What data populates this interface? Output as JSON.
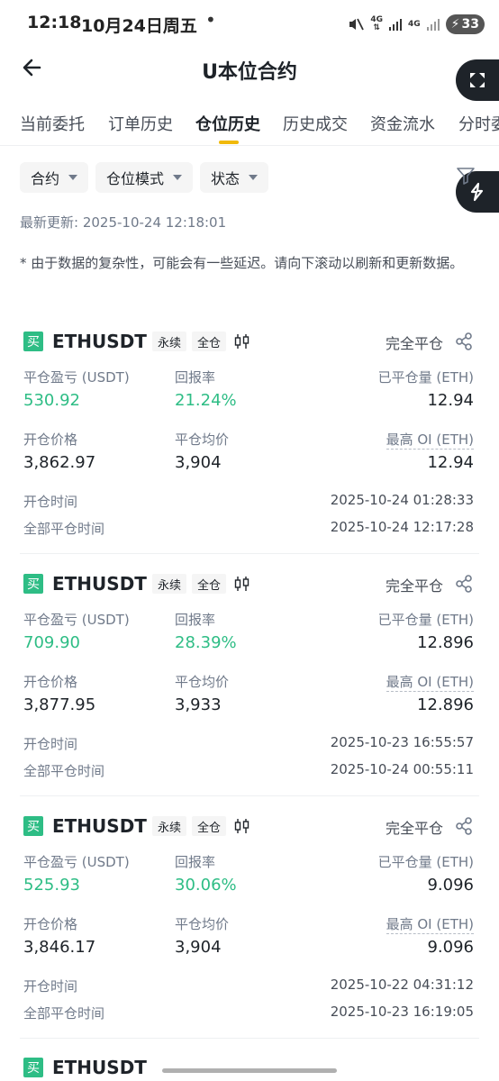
{
  "status_bar": {
    "time": "12:18",
    "date": "10月24日周五",
    "dot": "•",
    "net1": "4G",
    "net2": "4G",
    "battery": "33"
  },
  "header": {
    "title": "U本位合约"
  },
  "tabs": [
    {
      "label": "当前委托",
      "active": false
    },
    {
      "label": "订单历史",
      "active": false
    },
    {
      "label": "仓位历史",
      "active": true
    },
    {
      "label": "历史成交",
      "active": false
    },
    {
      "label": "资金流水",
      "active": false
    },
    {
      "label": "分时委",
      "active": false
    }
  ],
  "filters": {
    "contract": "合约",
    "position_mode": "仓位模式",
    "status": "状态"
  },
  "last_update": "最新更新: 2025-10-24 12:18:01",
  "notice": "* 由于数据的复杂性，可能会有一些延迟。请向下滚动以刷新和更新数据。",
  "labels": {
    "pnl": "平仓盈亏 (USDT)",
    "roi": "回报率",
    "closed_qty": "已平仓量 (ETH)",
    "entry_price": "开仓价格",
    "avg_close": "平仓均价",
    "max_oi": "最高 OI (ETH)",
    "open_time": "开仓时间",
    "close_time": "全部平仓时间"
  },
  "positions": [
    {
      "side": "买",
      "symbol": "ETHUSDT",
      "type": "永续",
      "margin": "全仓",
      "status": "完全平仓",
      "pnl": "530.92",
      "roi": "21.24%",
      "closed_qty": "12.94",
      "entry_price": "3,862.97",
      "avg_close": "3,904",
      "max_oi": "12.94",
      "open_time": "2025-10-24 01:28:33",
      "close_time": "2025-10-24 12:17:28"
    },
    {
      "side": "买",
      "symbol": "ETHUSDT",
      "type": "永续",
      "margin": "全仓",
      "status": "完全平仓",
      "pnl": "709.90",
      "roi": "28.39%",
      "closed_qty": "12.896",
      "entry_price": "3,877.95",
      "avg_close": "3,933",
      "max_oi": "12.896",
      "open_time": "2025-10-23 16:55:57",
      "close_time": "2025-10-24 00:55:11"
    },
    {
      "side": "买",
      "symbol": "ETHUSDT",
      "type": "永续",
      "margin": "全仓",
      "status": "完全平仓",
      "pnl": "525.93",
      "roi": "30.06%",
      "closed_qty": "9.096",
      "entry_price": "3,846.17",
      "avg_close": "3,904",
      "max_oi": "9.096",
      "open_time": "2025-10-22 04:31:12",
      "close_time": "2025-10-23 16:19:05"
    },
    {
      "side": "买",
      "symbol": "ETHUSDT"
    }
  ],
  "colors": {
    "profit_green": "#2ebd85",
    "tab_indicator": "#f0b90b",
    "text_primary": "#1e2329",
    "text_secondary": "#707a8a"
  }
}
